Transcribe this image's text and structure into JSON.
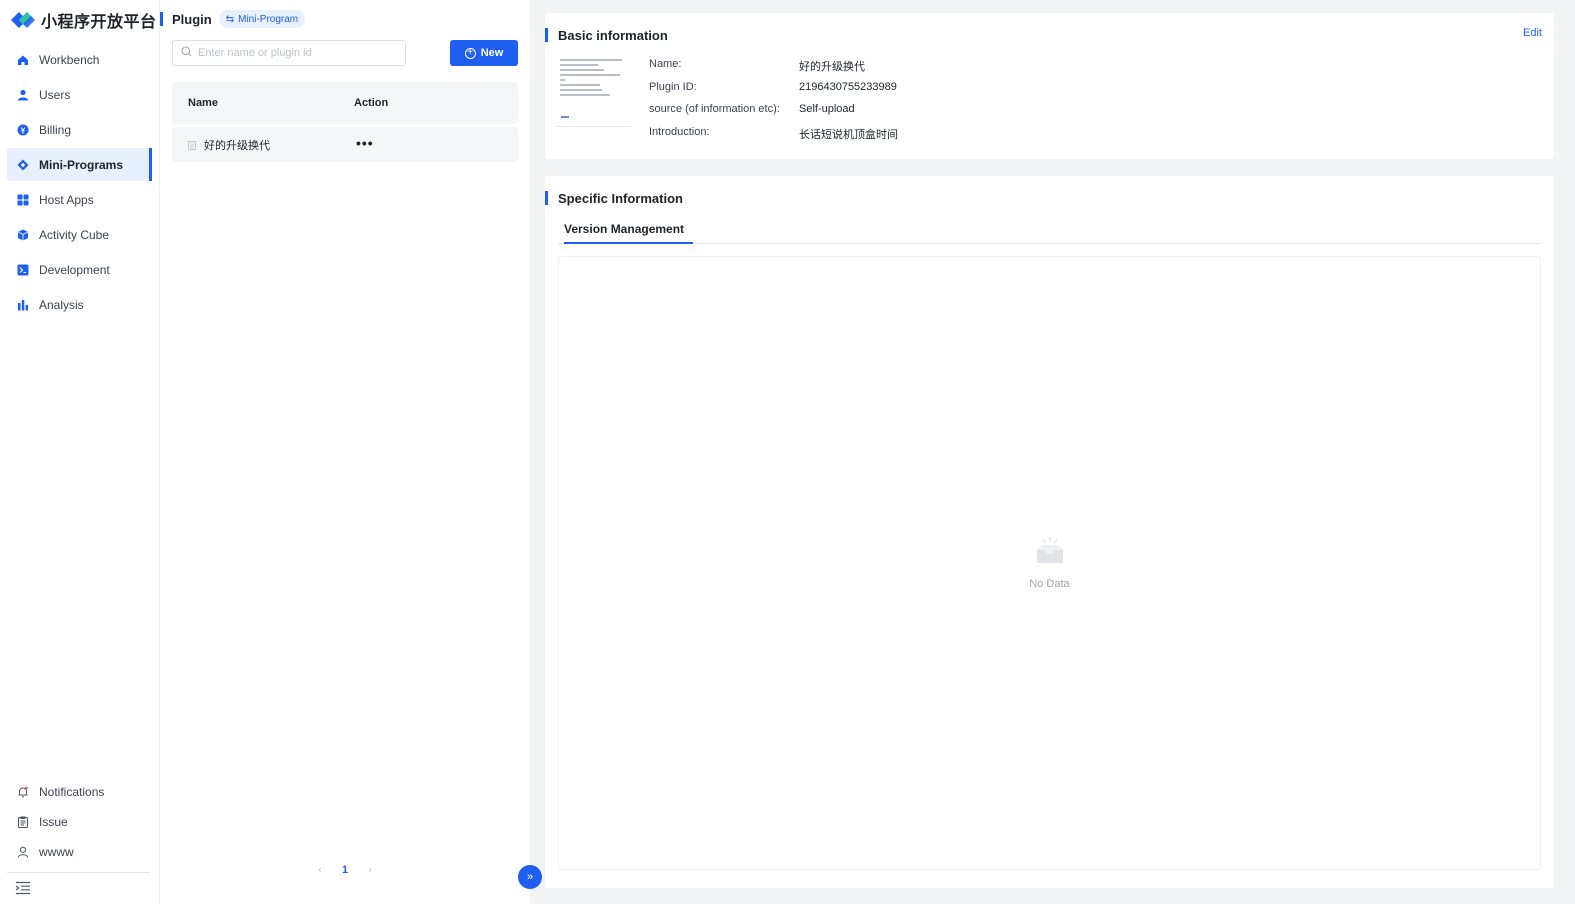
{
  "app": {
    "title": "小程序开放平台"
  },
  "sidebar": {
    "items": [
      {
        "label": "Workbench",
        "icon": "home-icon"
      },
      {
        "label": "Users",
        "icon": "user-icon"
      },
      {
        "label": "Billing",
        "icon": "billing-icon"
      },
      {
        "label": "Mini-Programs",
        "icon": "diamond-icon",
        "active": true
      },
      {
        "label": "Host Apps",
        "icon": "grid-icon"
      },
      {
        "label": "Activity Cube",
        "icon": "cube-icon"
      },
      {
        "label": "Development",
        "icon": "terminal-icon"
      },
      {
        "label": "Analysis",
        "icon": "bar-chart-icon"
      }
    ],
    "bottom": [
      {
        "label": "Notifications",
        "icon": "bell-icon"
      },
      {
        "label": "Issue",
        "icon": "clipboard-icon"
      },
      {
        "label": "wwww",
        "icon": "account-icon"
      }
    ]
  },
  "plugin_panel": {
    "title": "Plugin",
    "badge": "Mini-Program",
    "search_placeholder": "Enter name or plugin id",
    "new_label": "New",
    "columns": {
      "name": "Name",
      "action": "Action"
    },
    "rows": [
      {
        "name": "好的升级换代",
        "action": "•••"
      }
    ],
    "pagination": {
      "prev": "‹",
      "current": "1",
      "next": "›"
    },
    "expand_label": "»"
  },
  "basic_info": {
    "title": "Basic information",
    "edit_label": "Edit",
    "fields": [
      {
        "label": "Name:",
        "value": "好的升级换代"
      },
      {
        "label": "Plugin ID:",
        "value": "2196430755233989"
      },
      {
        "label": "source (of information etc):",
        "value": "Self-upload"
      },
      {
        "label": "Introduction:",
        "value": "长话短说机顶盒时间"
      }
    ]
  },
  "specific_info": {
    "title": "Specific Information",
    "tabs": [
      {
        "label": "Version Management",
        "active": true
      }
    ],
    "empty_text": "No Data"
  },
  "colors": {
    "accent": "#1f5ff0",
    "active_bg": "#e8efff",
    "page_bg": "#f2f3f5"
  }
}
